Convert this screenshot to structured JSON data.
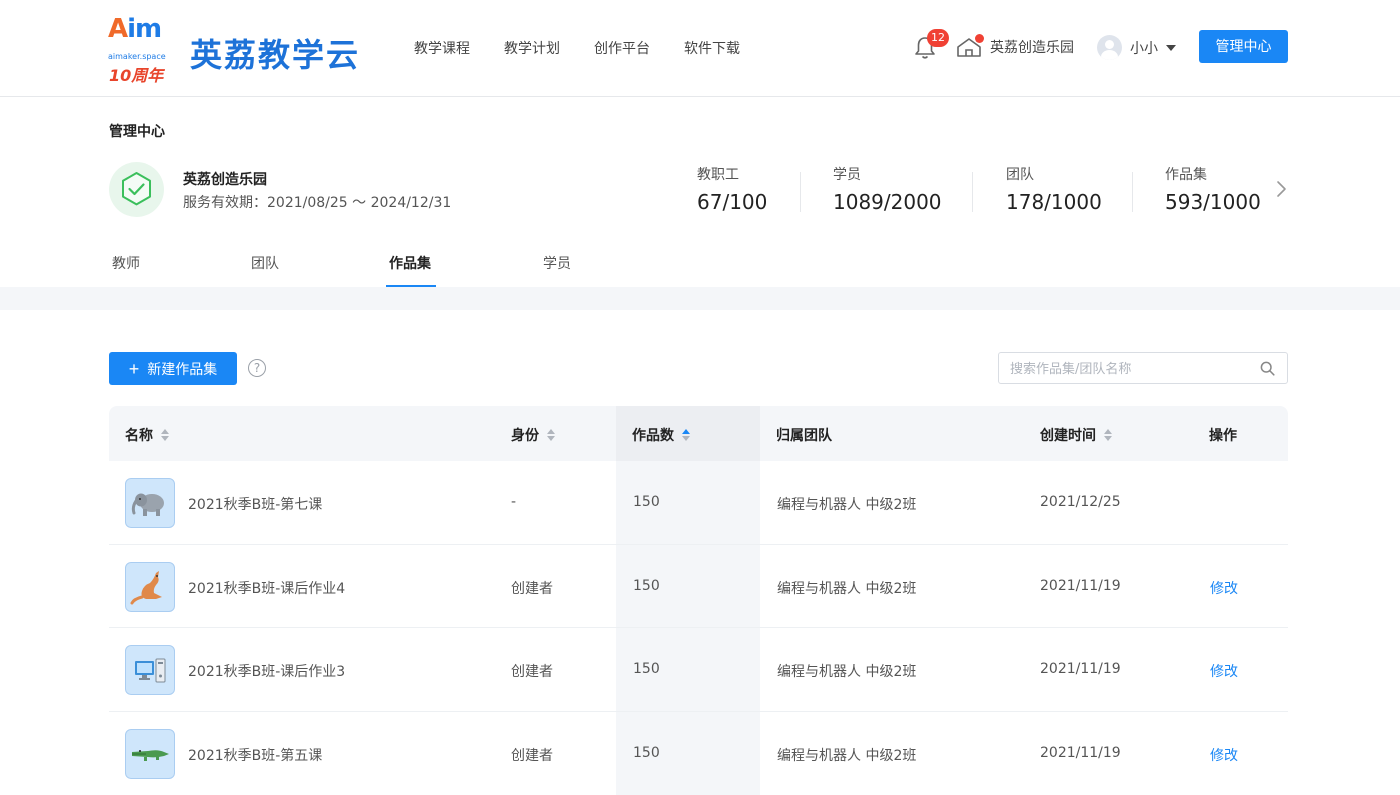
{
  "header": {
    "logo_text_a": "A",
    "logo_text_im": "im",
    "logo_sub": "aimaker.space",
    "logo_anniversary": "10周年",
    "brand": "英荔教学云",
    "nav": [
      "教学课程",
      "教学计划",
      "创作平台",
      "软件下载"
    ],
    "notification_count": "12",
    "school_name": "英荔创造乐园",
    "user_name": "小小",
    "admin_button": "管理中心",
    "icons": {
      "bell": "bell-icon",
      "school": "school-icon",
      "avatar": "avatar-icon",
      "dropdown": "caret-down-icon"
    }
  },
  "summary": {
    "page_title": "管理中心",
    "org_name": "英荔创造乐园",
    "validity": "服务有效期：2021/08/25 ～ 2024/12/31",
    "stats": [
      {
        "label": "教职工",
        "value": "67/100"
      },
      {
        "label": "学员",
        "value": "1089/2000"
      },
      {
        "label": "团队",
        "value": "178/1000"
      },
      {
        "label": "作品集",
        "value": "593/1000"
      }
    ]
  },
  "tabs": [
    "教师",
    "团队",
    "作品集",
    "学员"
  ],
  "active_tab": "作品集",
  "toolbar": {
    "new_button": "新建作品集",
    "help": "?",
    "search_placeholder": "搜索作品集/团队名称"
  },
  "table": {
    "columns": [
      "名称",
      "身份",
      "作品数",
      "归属团队",
      "创建时间",
      "操作"
    ],
    "rows": [
      {
        "thumb": "elephant",
        "name": "2021秋季B班-第七课",
        "role": "-",
        "count": "150",
        "team": "编程与机器人 中级2班",
        "created": "2021/12/25",
        "action": ""
      },
      {
        "thumb": "kangaroo",
        "name": "2021秋季B班-课后作业4",
        "role": "创建者",
        "count": "150",
        "team": "编程与机器人 中级2班",
        "created": "2021/11/19",
        "action": "修改"
      },
      {
        "thumb": "computer",
        "name": "2021秋季B班-课后作业3",
        "role": "创建者",
        "count": "150",
        "team": "编程与机器人 中级2班",
        "created": "2021/11/19",
        "action": "修改"
      },
      {
        "thumb": "crocodile",
        "name": "2021秋季B班-第五课",
        "role": "创建者",
        "count": "150",
        "team": "编程与机器人 中级2班",
        "created": "2021/11/19",
        "action": "修改"
      }
    ]
  },
  "colors": {
    "primary": "#1a87f5",
    "brand": "#1d72d8",
    "badge": "#f04134",
    "success": "#3bbf5c"
  }
}
